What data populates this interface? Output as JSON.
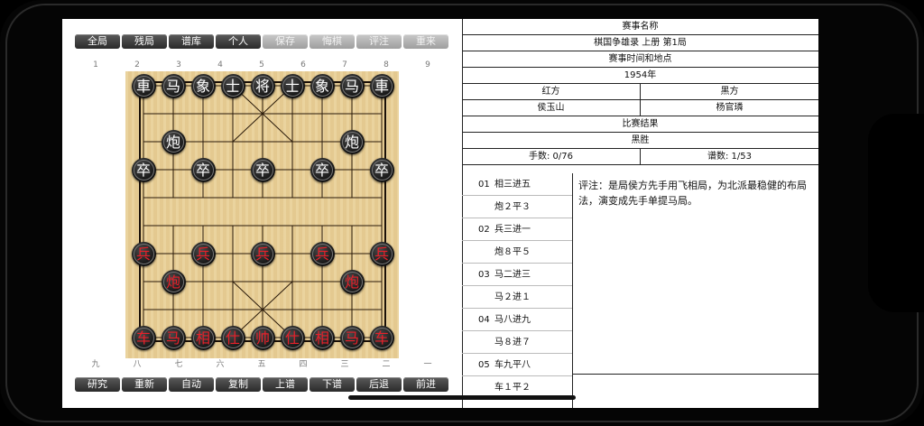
{
  "toolbar_top": [
    {
      "label": "全局",
      "enabled": true
    },
    {
      "label": "残局",
      "enabled": true
    },
    {
      "label": "谱库",
      "enabled": true
    },
    {
      "label": "个人",
      "enabled": true
    },
    {
      "label": "保存",
      "enabled": false
    },
    {
      "label": "悔棋",
      "enabled": false
    },
    {
      "label": "评注",
      "enabled": false
    },
    {
      "label": "重来",
      "enabled": false
    }
  ],
  "toolbar_bottom": [
    {
      "label": "研究"
    },
    {
      "label": "重新"
    },
    {
      "label": "自动"
    },
    {
      "label": "复制"
    },
    {
      "label": "上谱"
    },
    {
      "label": "下谱"
    },
    {
      "label": "后退"
    },
    {
      "label": "前进"
    }
  ],
  "files_top": [
    "1",
    "2",
    "3",
    "4",
    "5",
    "6",
    "7",
    "8",
    "9"
  ],
  "files_bottom": [
    "九",
    "八",
    "七",
    "六",
    "五",
    "四",
    "三",
    "二",
    "一"
  ],
  "pieces": [
    {
      "char": "車",
      "side": "black",
      "col": 0,
      "row": 0
    },
    {
      "char": "马",
      "side": "black",
      "col": 1,
      "row": 0
    },
    {
      "char": "象",
      "side": "black",
      "col": 2,
      "row": 0
    },
    {
      "char": "士",
      "side": "black",
      "col": 3,
      "row": 0
    },
    {
      "char": "将",
      "side": "black",
      "col": 4,
      "row": 0
    },
    {
      "char": "士",
      "side": "black",
      "col": 5,
      "row": 0
    },
    {
      "char": "象",
      "side": "black",
      "col": 6,
      "row": 0
    },
    {
      "char": "马",
      "side": "black",
      "col": 7,
      "row": 0
    },
    {
      "char": "車",
      "side": "black",
      "col": 8,
      "row": 0
    },
    {
      "char": "炮",
      "side": "black",
      "col": 1,
      "row": 2
    },
    {
      "char": "炮",
      "side": "black",
      "col": 7,
      "row": 2
    },
    {
      "char": "卒",
      "side": "black",
      "col": 0,
      "row": 3
    },
    {
      "char": "卒",
      "side": "black",
      "col": 2,
      "row": 3
    },
    {
      "char": "卒",
      "side": "black",
      "col": 4,
      "row": 3
    },
    {
      "char": "卒",
      "side": "black",
      "col": 6,
      "row": 3
    },
    {
      "char": "卒",
      "side": "black",
      "col": 8,
      "row": 3
    },
    {
      "char": "兵",
      "side": "red",
      "col": 0,
      "row": 6
    },
    {
      "char": "兵",
      "side": "red",
      "col": 2,
      "row": 6
    },
    {
      "char": "兵",
      "side": "red",
      "col": 4,
      "row": 6
    },
    {
      "char": "兵",
      "side": "red",
      "col": 6,
      "row": 6
    },
    {
      "char": "兵",
      "side": "red",
      "col": 8,
      "row": 6
    },
    {
      "char": "炮",
      "side": "red",
      "col": 1,
      "row": 7
    },
    {
      "char": "炮",
      "side": "red",
      "col": 7,
      "row": 7
    },
    {
      "char": "车",
      "side": "red",
      "col": 0,
      "row": 9
    },
    {
      "char": "马",
      "side": "red",
      "col": 1,
      "row": 9
    },
    {
      "char": "相",
      "side": "red",
      "col": 2,
      "row": 9
    },
    {
      "char": "仕",
      "side": "red",
      "col": 3,
      "row": 9
    },
    {
      "char": "帅",
      "side": "red",
      "col": 4,
      "row": 9
    },
    {
      "char": "仕",
      "side": "red",
      "col": 5,
      "row": 9
    },
    {
      "char": "相",
      "side": "red",
      "col": 6,
      "row": 9
    },
    {
      "char": "马",
      "side": "red",
      "col": 7,
      "row": 9
    },
    {
      "char": "车",
      "side": "red",
      "col": 8,
      "row": 9
    }
  ],
  "info": {
    "event_label": "赛事名称",
    "event_value": "棋国争雄录 上册 第1局",
    "time_place_label": "赛事时间和地点",
    "time_place_value": "1954年",
    "red_label": "红方",
    "black_label": "黑方",
    "red_player": "侯玉山",
    "black_player": "杨官璘",
    "result_label": "比赛结果",
    "result_value": "黑胜",
    "moves_count": "手数: 0/76",
    "records_count": "谱数: 1/53"
  },
  "moves": [
    {
      "num": "01",
      "text": "相三进五"
    },
    {
      "num": "",
      "text": "炮２平３"
    },
    {
      "num": "02",
      "text": "兵三进一"
    },
    {
      "num": "",
      "text": "炮８平５"
    },
    {
      "num": "03",
      "text": "马二进三"
    },
    {
      "num": "",
      "text": "马２进１"
    },
    {
      "num": "04",
      "text": "马八进九"
    },
    {
      "num": "",
      "text": "马８进７"
    },
    {
      "num": "05",
      "text": "车九平八"
    },
    {
      "num": "",
      "text": "车１平２"
    }
  ],
  "comment": "评注：是局侯方先手用飞相局，为北派最稳健的布局法，演变成先手单提马局。"
}
